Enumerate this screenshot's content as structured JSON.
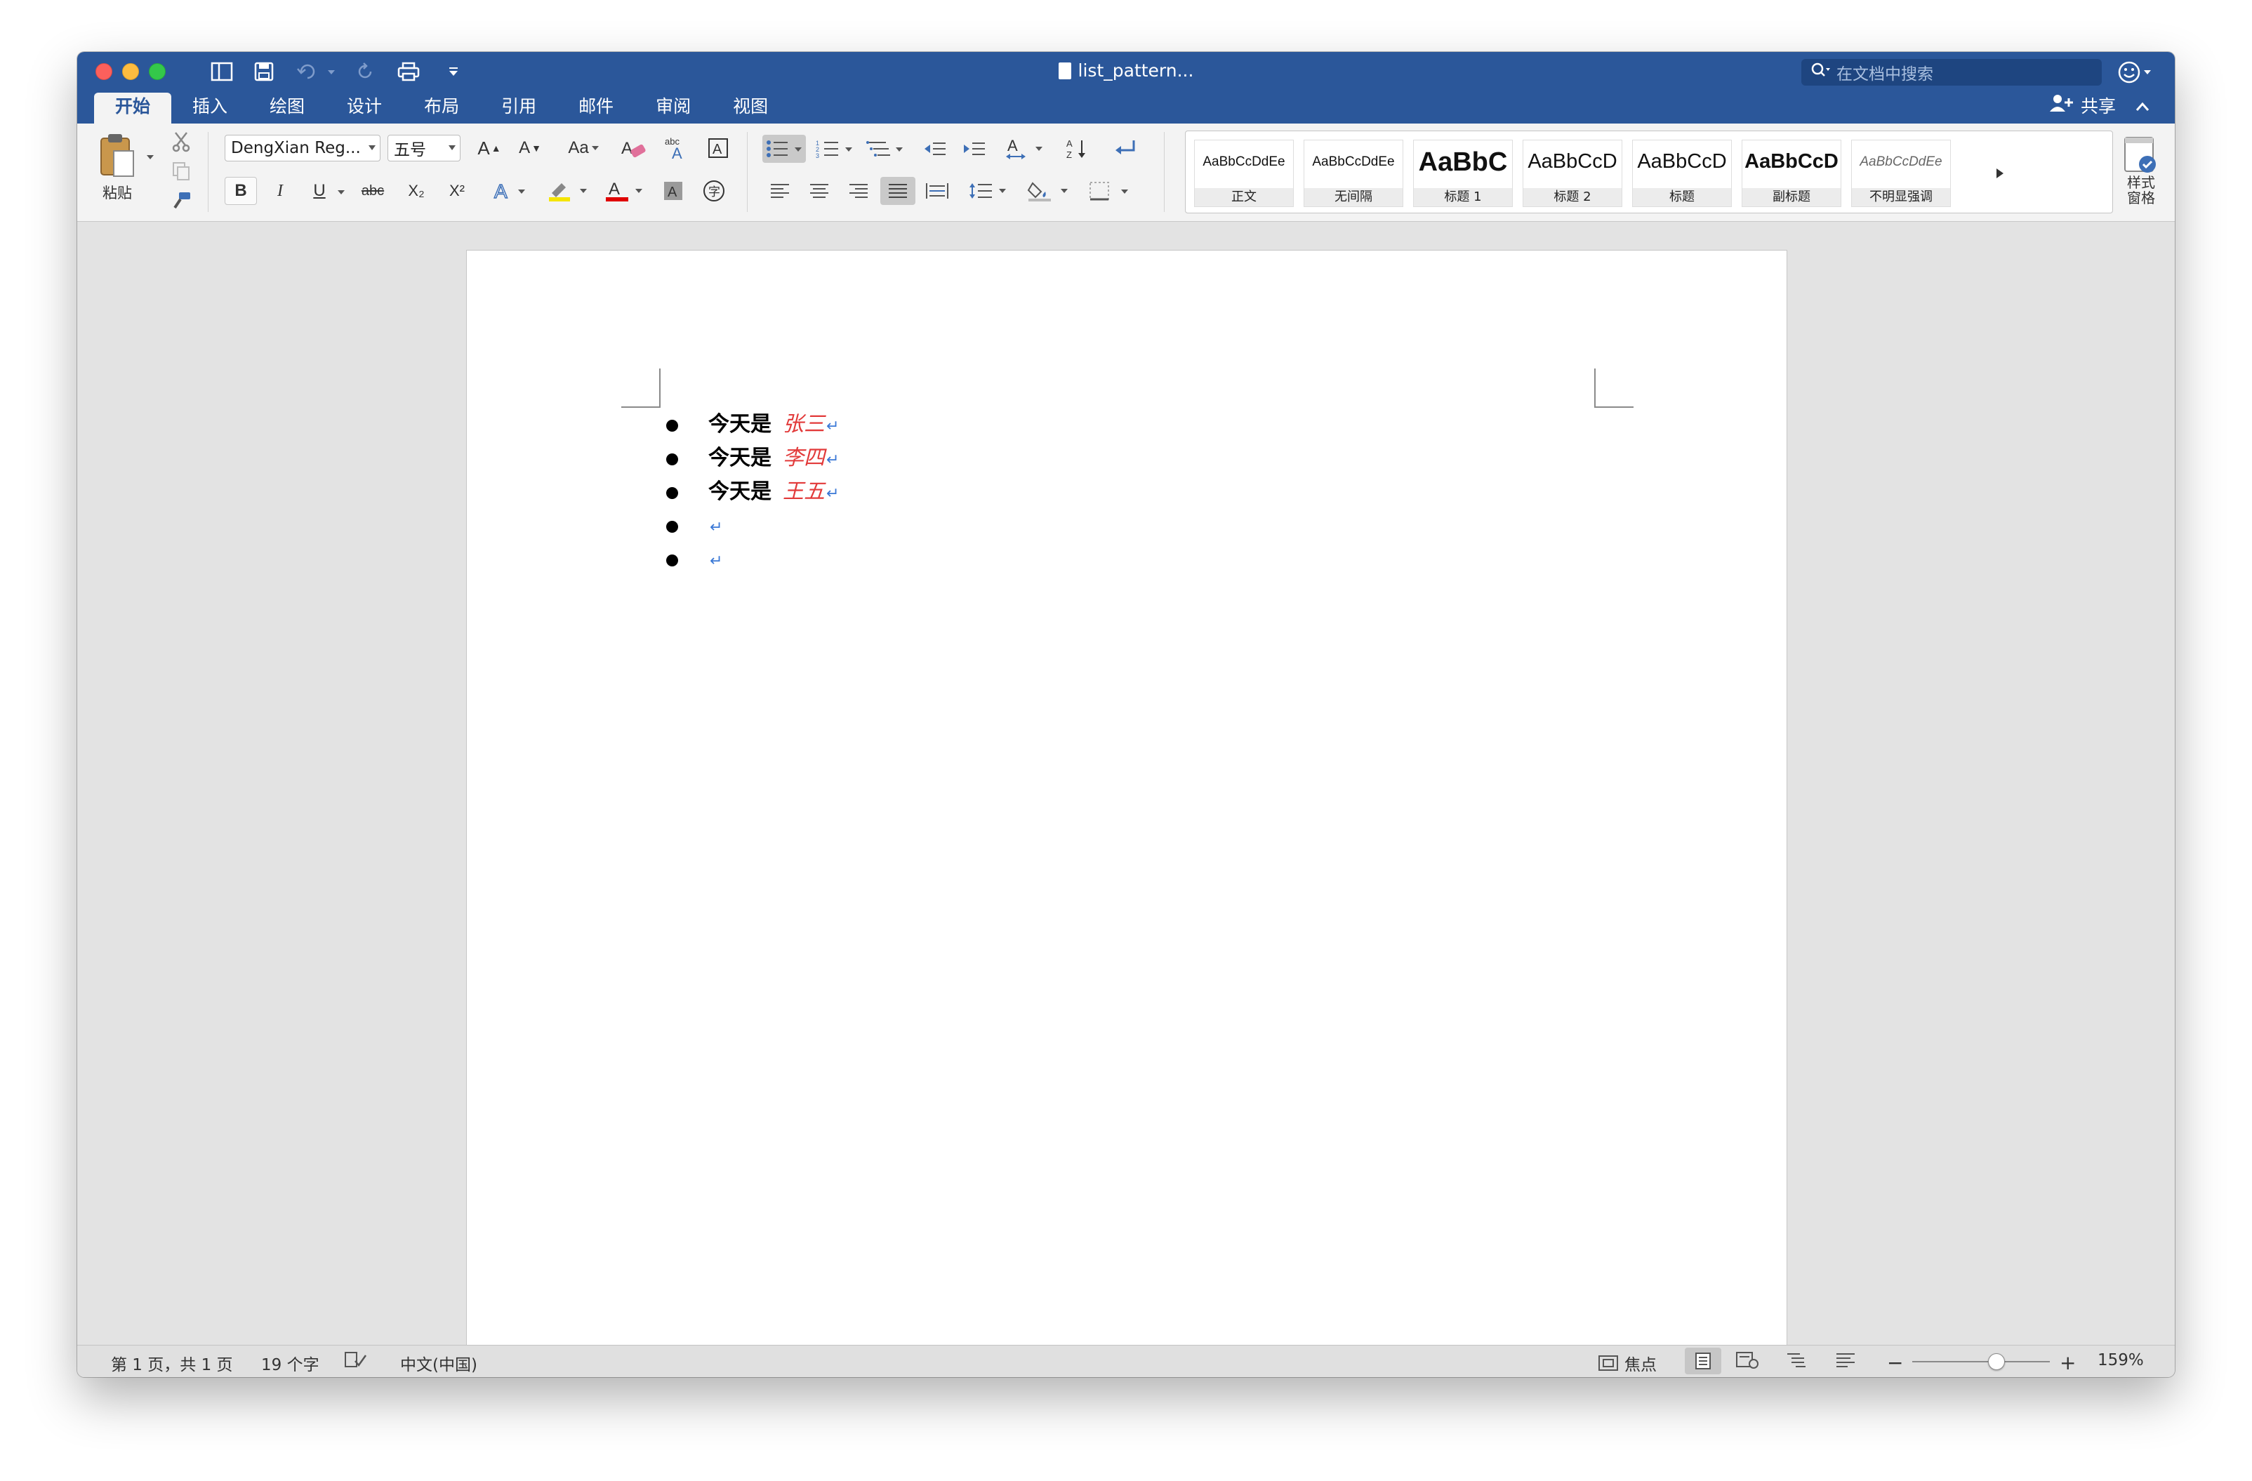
{
  "window": {
    "title": "list_pattern...",
    "search_placeholder": "在文档中搜索"
  },
  "tabs": [
    {
      "label": "开始",
      "active": true
    },
    {
      "label": "插入"
    },
    {
      "label": "绘图"
    },
    {
      "label": "设计"
    },
    {
      "label": "布局"
    },
    {
      "label": "引用"
    },
    {
      "label": "邮件"
    },
    {
      "label": "审阅"
    },
    {
      "label": "视图"
    }
  ],
  "share_label": "共享",
  "ribbon": {
    "paste_label": "粘贴",
    "font_name": "DengXian Reg...",
    "font_size": "五号",
    "styles": [
      {
        "sample": "AaBbCcDdEe",
        "label": "正文"
      },
      {
        "sample": "AaBbCcDdEe",
        "label": "无间隔"
      },
      {
        "sample": "AaBbC",
        "label": "标题 1"
      },
      {
        "sample": "AaBbCcD",
        "label": "标题 2"
      },
      {
        "sample": "AaBbCcD",
        "label": "标题"
      },
      {
        "sample": "AaBbCcD",
        "label": "副标题"
      },
      {
        "sample": "AaBbCcDdEe",
        "label": "不明显强调"
      }
    ],
    "styles_pane_label_1": "样式",
    "styles_pane_label_2": "窗格",
    "bold": "B",
    "italic": "I",
    "underline": "U",
    "strike": "abc",
    "subscript": "X₂",
    "superscript": "X²"
  },
  "document": {
    "items": [
      {
        "prefix": "今天是",
        "name": "张三",
        "pilcrow": "↵"
      },
      {
        "prefix": "今天是",
        "name": "李四",
        "pilcrow": "↵"
      },
      {
        "prefix": "今天是",
        "name": "王五",
        "pilcrow": "↵"
      },
      {
        "prefix": "",
        "name": "",
        "pilcrow": "↵"
      },
      {
        "prefix": "",
        "name": "",
        "pilcrow": "↵"
      }
    ]
  },
  "status": {
    "page": "第 1 页，共 1 页",
    "words": "19 个字",
    "language": "中文(中国)",
    "focus": "焦点",
    "zoom": "159%"
  },
  "colors": {
    "title_bar": "#2b579a",
    "name_text": "#e23a3a",
    "pilcrow": "#3a78d6"
  }
}
